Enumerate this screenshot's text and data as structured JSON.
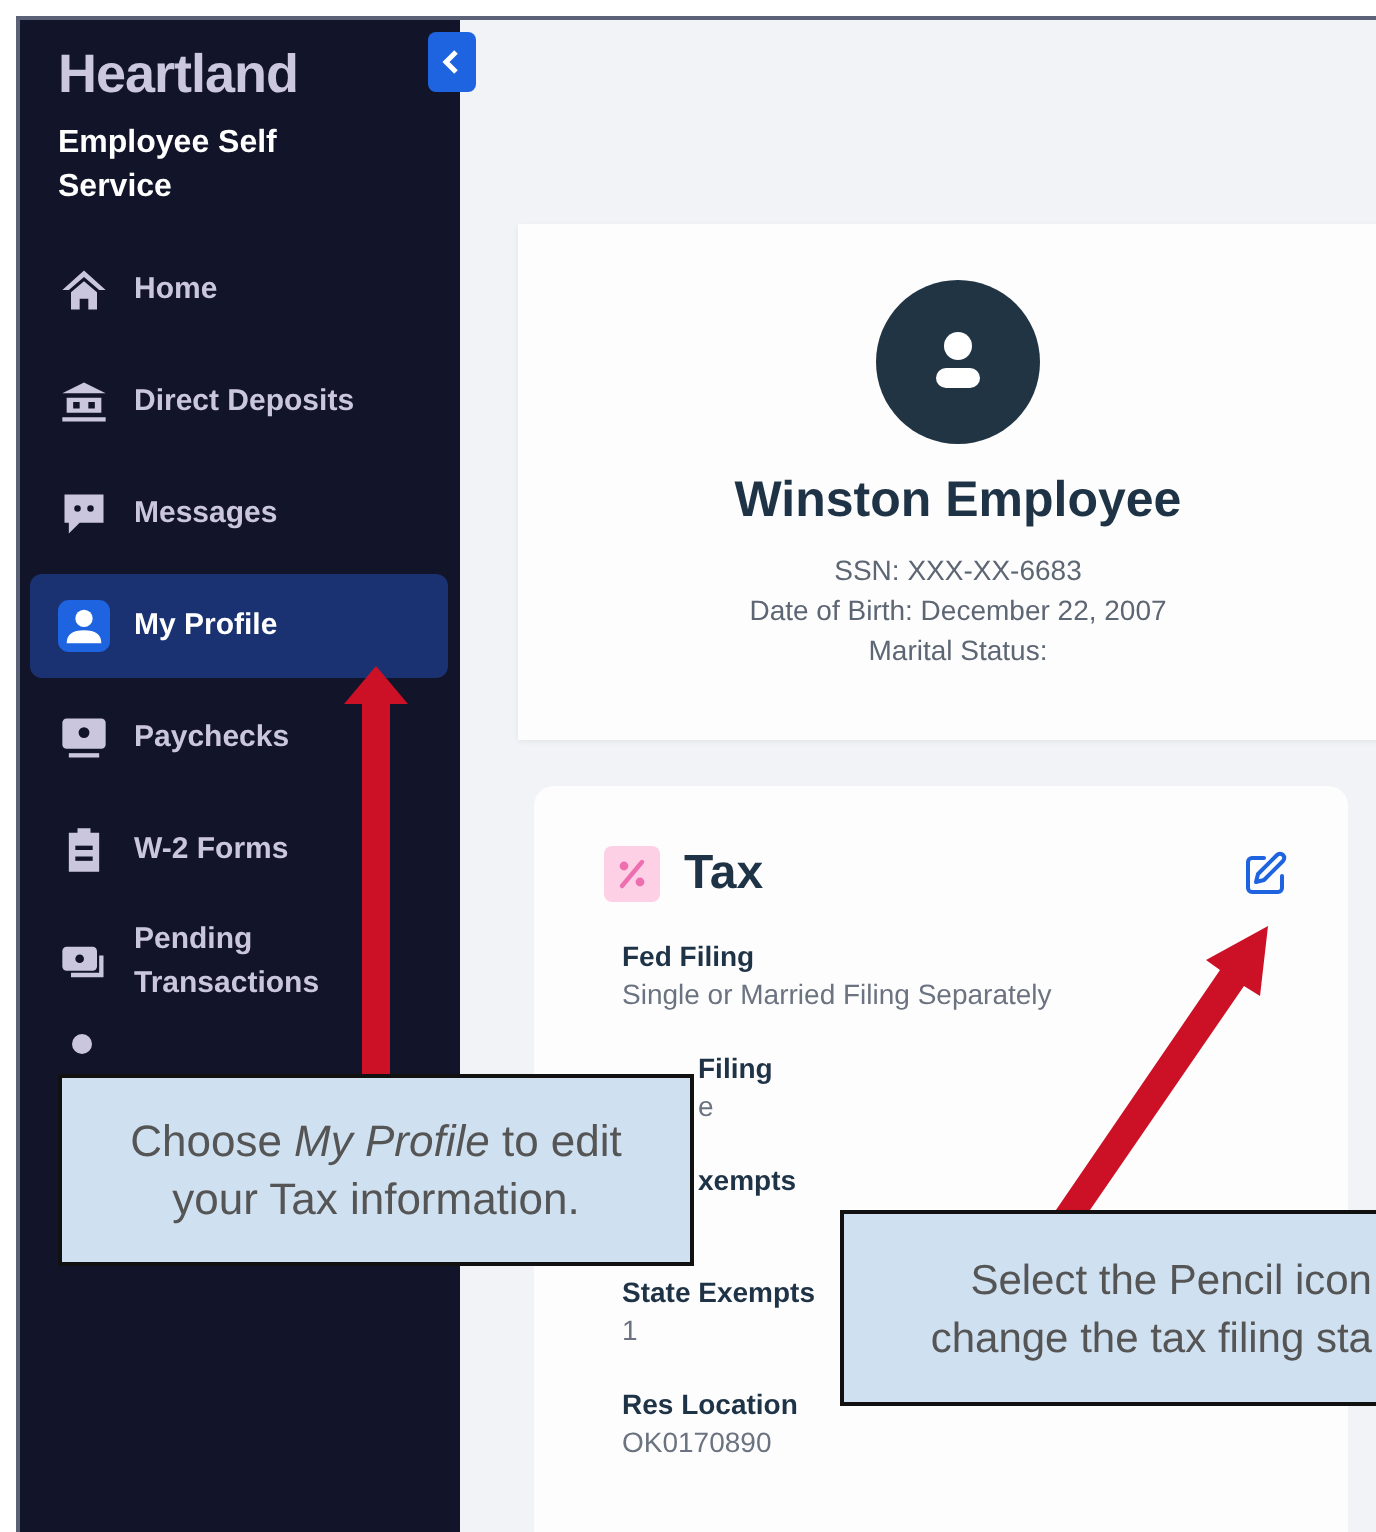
{
  "brand": {
    "logo": "Heartland",
    "subtitle": "Employee Self Service"
  },
  "sidebar": {
    "items": [
      {
        "label": "Home",
        "selected": false
      },
      {
        "label": "Direct Deposits",
        "selected": false
      },
      {
        "label": "Messages",
        "selected": false
      },
      {
        "label": "My Profile",
        "selected": true
      },
      {
        "label": "Paychecks",
        "selected": false
      },
      {
        "label": "W-2 Forms",
        "selected": false
      },
      {
        "label": "Pending Transactions",
        "selected": false
      },
      {
        "selected": false
      }
    ]
  },
  "profile": {
    "name": "Winston Employee",
    "details": [
      "SSN: XXX-XX-6683",
      "Date of Birth: December 22, 2007",
      "Marital Status:"
    ]
  },
  "tax": {
    "title": "Tax",
    "fields": [
      {
        "label": "Fed Filing",
        "value": "Single or Married Filing Separately",
        "covered": false
      },
      {
        "label": "Filing",
        "value": "e",
        "covered": true
      },
      {
        "label": "xempts",
        "covered": true
      },
      {
        "label": "State Exempts",
        "value": "1",
        "covered": false
      },
      {
        "label": "Res Location",
        "value": "OK0170890",
        "covered": false
      }
    ]
  },
  "callouts": [
    {
      "lines": [
        "Choose *My Profile* to edit your Tax information."
      ]
    },
    {
      "lines": [
        "Select the Pencil icon",
        "change the tax filing sta"
      ]
    }
  ]
}
